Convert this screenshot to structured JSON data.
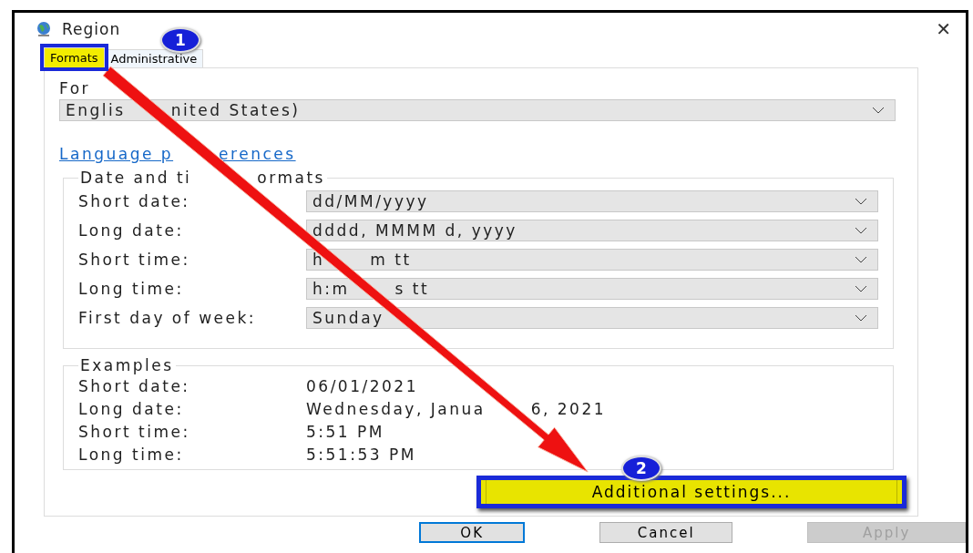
{
  "window": {
    "title": "Region",
    "close": "✕"
  },
  "annotations": [
    {
      "number": "1"
    },
    {
      "number": "2"
    }
  ],
  "tabs": [
    {
      "label": "Formats",
      "selected": true,
      "highlighted": true
    },
    {
      "label": "Administrative",
      "selected": false,
      "highlighted": false
    }
  ],
  "format": {
    "label": "For",
    "value_parts": [
      "Englis",
      "nited States)"
    ]
  },
  "link_parts": [
    "Language p",
    "erences"
  ],
  "date_time_group": {
    "title_parts": [
      "Date and ti",
      "ormats"
    ],
    "rows": [
      {
        "label": "Short date:",
        "value_parts": [
          "dd/MM/yyyy"
        ]
      },
      {
        "label": "Long date:",
        "value_parts": [
          "dddd, MMMM d, yyyy"
        ]
      },
      {
        "label": "Short time:",
        "value_parts": [
          "h",
          "m tt"
        ]
      },
      {
        "label": "Long time:",
        "value_parts": [
          "h:m",
          "s tt"
        ]
      },
      {
        "label": "First day of week:",
        "value_parts": [
          "Sunday"
        ]
      }
    ]
  },
  "examples_group": {
    "title": "Examples",
    "rows": [
      {
        "label": "Short date:",
        "value_parts": [
          "06/01/2021"
        ]
      },
      {
        "label": "Long date:",
        "value_parts": [
          "Wednesday, Janua",
          "6, 2021"
        ]
      },
      {
        "label": "Short time:",
        "value_parts": [
          "5:51 PM"
        ]
      },
      {
        "label": "Long time:",
        "value_parts": [
          "5:51:53 PM"
        ]
      }
    ]
  },
  "additional_button": {
    "label": "Additional settings...",
    "highlighted": true
  },
  "buttons": [
    {
      "label": "OK",
      "kind": "default"
    },
    {
      "label": "Cancel",
      "kind": "normal"
    },
    {
      "label": "Apply",
      "kind": "disabled"
    }
  ]
}
